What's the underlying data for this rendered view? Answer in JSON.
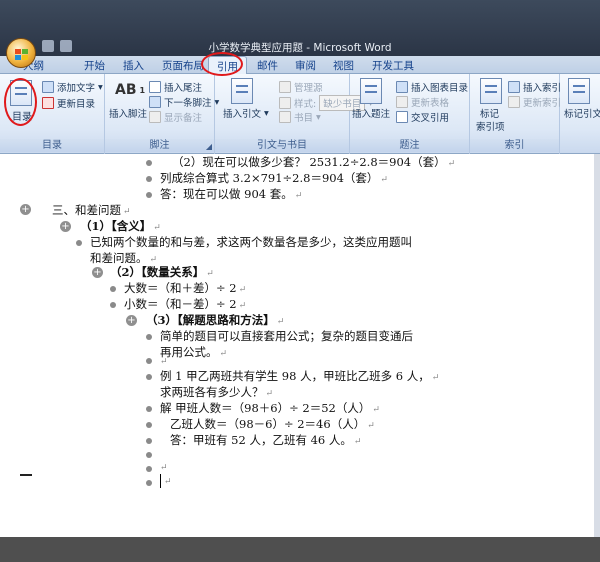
{
  "window": {
    "title": "小学数学典型应用题 - Microsoft Word"
  },
  "tabs": [
    "大纲",
    "开始",
    "插入",
    "页面布局",
    "引用",
    "邮件",
    "审阅",
    "视图",
    "开发工具"
  ],
  "active_tab": "引用",
  "ribbon": {
    "toc": {
      "button": "目录",
      "add_text": "添加文字",
      "update": "更新目录",
      "group": "目录"
    },
    "footnotes": {
      "insert": "插入脚注",
      "insert_endnote": "插入尾注",
      "next": "下一条脚注",
      "show": "显示备注",
      "group": "脚注"
    },
    "citations": {
      "insert": "插入引文",
      "manage": "管理源",
      "style_label": "样式:",
      "style_value": "缺少书目",
      "biblio": "书目",
      "group": "引文与书目"
    },
    "captions": {
      "insert": "插入题注",
      "insert_table": "插入图表目录",
      "update_table": "更新表格",
      "cross": "交叉引用",
      "group": "题注"
    },
    "index": {
      "mark": "标记",
      "mark2": "索引项",
      "insert": "插入索引",
      "update": "更新索引",
      "group": "索引"
    },
    "authorities": {
      "mark": "标记引文"
    }
  },
  "document": {
    "l1": "（2）现在可以做多少套？ 2531.2÷2.8＝904（套）",
    "l2": "列成综合算式 3.2×791÷2.8＝904（套）",
    "l3": "答：现在可以做 904 套。",
    "l4": "三、和差问题",
    "l5": "（1）【含义】",
    "l6a": "已知两个数量的和与差，求这两个数量各是多少，这类应用题叫",
    "l6b": "和差问题。",
    "l7": "（2）【数量关系】",
    "l8": "大数＝（和＋差）÷ 2",
    "l9": "小数＝（和－差）÷ 2",
    "l10": "（3）【解题思路和方法】",
    "l11a": "简单的题目可以直接套用公式；复杂的题目变通后",
    "l11b": "再用公式。",
    "l12a": "例 1 甲乙两班共有学生 98 人，甲班比乙班多 6 人，",
    "l12b": "求两班各有多少人？",
    "l13": "解  甲班人数＝（98＋6）÷ 2＝52（人）",
    "l14": "乙班人数＝（98－6）÷ 2＝46（人）",
    "l15": "答：甲班有 52 人，乙班有 46 人。",
    "pm": "↵"
  }
}
